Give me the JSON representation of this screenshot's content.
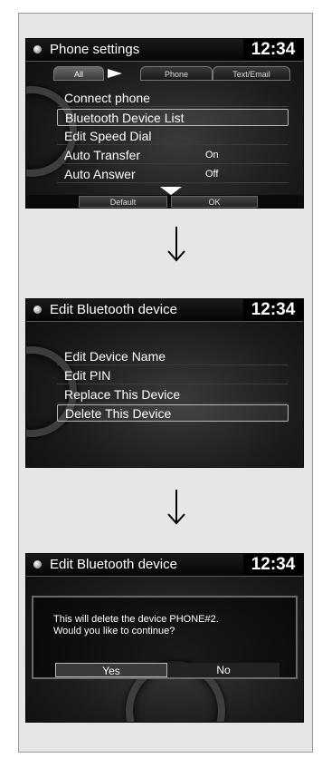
{
  "screen1": {
    "title": "Phone settings",
    "time": "12:34",
    "tabs": [
      "All",
      "Phone",
      "Text/Email"
    ],
    "items": [
      {
        "label": "Connect phone",
        "value": ""
      },
      {
        "label": "Bluetooth Device List",
        "value": ""
      },
      {
        "label": "Edit Speed Dial",
        "value": ""
      },
      {
        "label": "Auto Transfer",
        "value": "On"
      },
      {
        "label": "Auto Answer",
        "value": "Off"
      }
    ],
    "softkeys": {
      "default": "Default",
      "ok": "OK"
    }
  },
  "screen2": {
    "title": "Edit Bluetooth device",
    "time": "12:34",
    "items": [
      {
        "label": "Edit Device Name"
      },
      {
        "label": "Edit PIN"
      },
      {
        "label": "Replace This Device"
      },
      {
        "label": "Delete This Device"
      }
    ]
  },
  "screen3": {
    "title": "Edit Bluetooth device",
    "time": "12:34",
    "message_line1": "This will delete the device PHONE#2.",
    "message_line2": "Would you like to continue?",
    "yes": "Yes",
    "no": "No"
  },
  "icons": [
    "title-dot-icon",
    "tab-arrow-icon",
    "scroll-down-icon",
    "flow-arrow-icon"
  ],
  "colors": {
    "screen_bg": "#1c1c1c",
    "frame_bg": "#e6e6e6",
    "text": "#ffffff",
    "selection_border": "#b8b8b8"
  }
}
